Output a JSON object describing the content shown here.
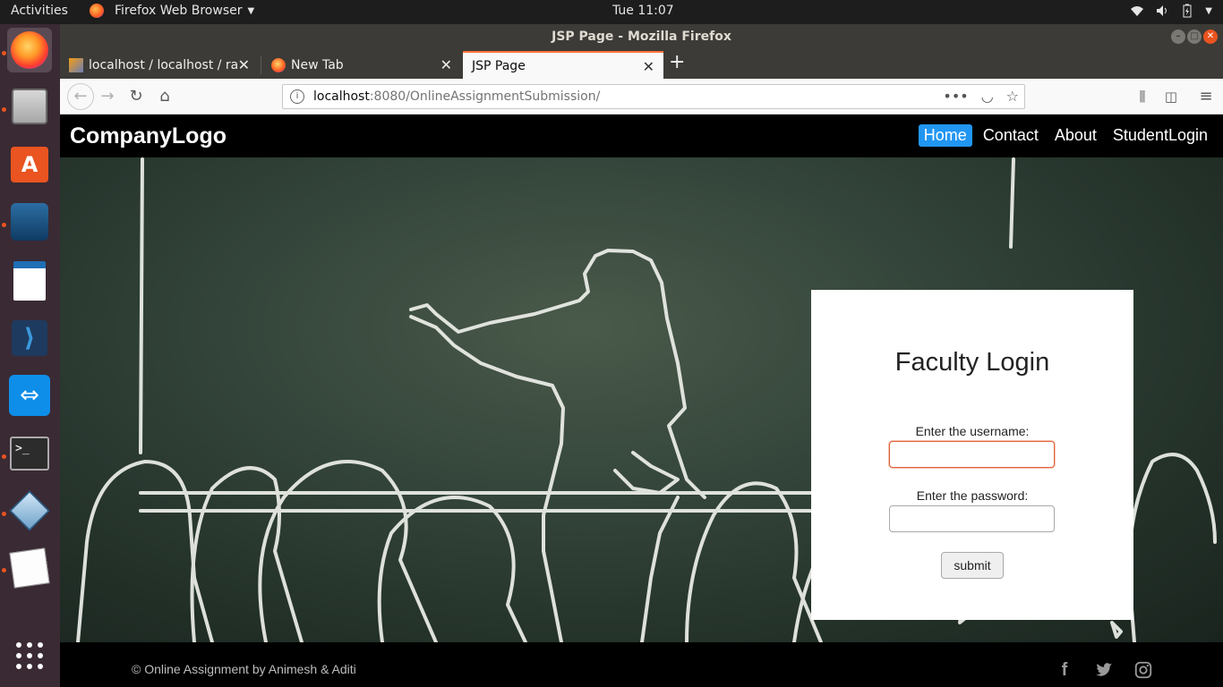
{
  "topbar": {
    "activities": "Activities",
    "app_name": "Firefox Web Browser",
    "clock": "Tue 11:07"
  },
  "window": {
    "title": "JSP Page - Mozilla Firefox"
  },
  "tabs": [
    {
      "label": "localhost / localhost / ra"
    },
    {
      "label": "New Tab"
    },
    {
      "label": "JSP Page"
    }
  ],
  "address": {
    "host": "localhost",
    "rest": ":8080/OnlineAssignmentSubmission/"
  },
  "site": {
    "logo": "CompanyLogo",
    "menu": [
      "Home",
      "Contact",
      "About",
      "StudentLogin"
    ],
    "active_menu": "Home"
  },
  "login": {
    "title": "Faculty Login",
    "username_label": "Enter the username:",
    "password_label": "Enter the password:",
    "submit_label": "submit"
  },
  "footer": {
    "copyright": "© Online Assignment by Animesh & Aditi",
    "social": [
      "facebook-icon",
      "twitter-icon",
      "instagram-icon"
    ]
  },
  "colors": {
    "nav_bg": "#000000",
    "active_menu": "#2196f3",
    "chalkboard": "#33443a",
    "ubuntu_accent": "#e95420"
  }
}
